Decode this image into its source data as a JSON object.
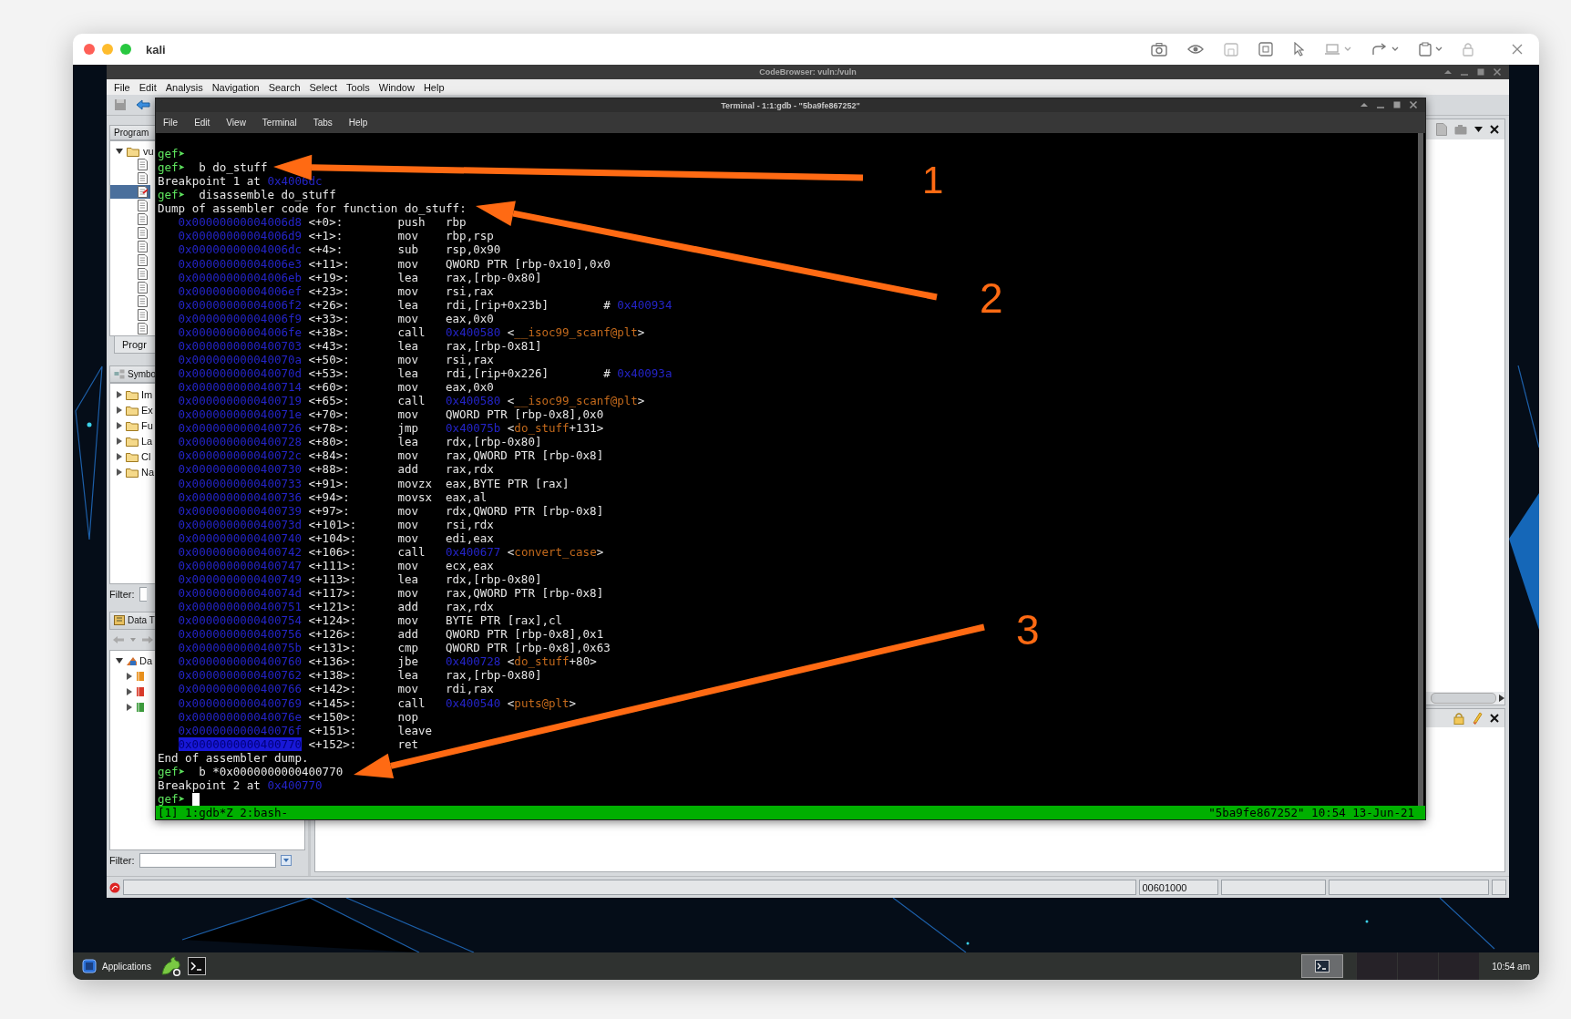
{
  "host_window": {
    "title": "kali"
  },
  "ghidra": {
    "title": "CodeBrowser: vuln:/vuln",
    "menu": [
      "File",
      "Edit",
      "Analysis",
      "Navigation",
      "Search",
      "Select",
      "Tools",
      "Window",
      "Help"
    ],
    "program_tree": {
      "header": "Program",
      "root": {
        "label": "vu",
        "expanded": true,
        "children": [
          {
            "selected": false
          },
          {
            "selected": false
          },
          {
            "selected": true
          },
          {
            "selected": false
          },
          {
            "selected": false
          },
          {
            "selected": false
          },
          {
            "selected": false
          },
          {
            "selected": false
          },
          {
            "selected": false
          },
          {
            "selected": false
          },
          {
            "selected": false
          },
          {
            "selected": false
          },
          {
            "selected": false
          }
        ]
      },
      "tab": "Progr"
    },
    "symbol_tree": {
      "header": "Symbo",
      "items": [
        {
          "label": "Im",
          "expanded": false
        },
        {
          "label": "Ex",
          "expanded": false
        },
        {
          "label": "Fu",
          "expanded": false
        },
        {
          "label": "La",
          "expanded": false
        },
        {
          "label": "Cl",
          "expanded": false
        },
        {
          "label": "Na",
          "expanded": false
        }
      ],
      "filter_label": "Filter:"
    },
    "data_type_manager": {
      "header": "Data T",
      "root": {
        "label": "Da",
        "expanded": true,
        "children": [
          {
            "color": "#e8901c",
            "expanded": false
          },
          {
            "color": "#d83a2a",
            "expanded": false
          },
          {
            "color": "#3c9a3c",
            "expanded": false
          }
        ]
      },
      "filter_label": "Filter:"
    },
    "status_bar": {
      "address": "00601000"
    }
  },
  "terminal": {
    "title": "Terminal - 1:1:gdb - \"5ba9fe867252\"",
    "menu": [
      "File",
      "Edit",
      "View",
      "Terminal",
      "Tabs",
      "Help"
    ],
    "lines": [
      {
        "kind": "text",
        "segments": [
          {
            "kind": "prompt",
            "text": "gef➤"
          }
        ]
      },
      {
        "kind": "text",
        "segments": [
          {
            "kind": "prompt",
            "text": "gef➤"
          },
          {
            "kind": "plain",
            "text": "  b do_stuff"
          }
        ]
      },
      {
        "kind": "text",
        "segments": [
          {
            "kind": "plain",
            "text": "Breakpoint 1 at "
          },
          {
            "kind": "address",
            "text": "0x4006dc"
          }
        ]
      },
      {
        "kind": "text",
        "segments": [
          {
            "kind": "prompt",
            "text": "gef➤"
          },
          {
            "kind": "plain",
            "text": "  disassemble do_stuff"
          }
        ]
      },
      {
        "kind": "text",
        "segments": [
          {
            "kind": "plain",
            "text": "Dump of assembler code for function do_stuff:"
          }
        ]
      },
      {
        "kind": "asm",
        "segments": [
          {
            "kind": "address",
            "text": "0x00000000004006d8"
          },
          {
            "kind": "plain",
            "text": " <+0>:\tpush   rbp"
          }
        ]
      },
      {
        "kind": "asm",
        "segments": [
          {
            "kind": "address",
            "text": "0x00000000004006d9"
          },
          {
            "kind": "plain",
            "text": " <+1>:\tmov    rbp,rsp"
          }
        ]
      },
      {
        "kind": "asm",
        "segments": [
          {
            "kind": "address",
            "text": "0x00000000004006dc"
          },
          {
            "kind": "plain",
            "text": " <+4>:\tsub    rsp,0x90"
          }
        ]
      },
      {
        "kind": "asm",
        "segments": [
          {
            "kind": "address",
            "text": "0x00000000004006e3"
          },
          {
            "kind": "plain",
            "text": " <+11>:\tmov    QWORD PTR [rbp-0x10],0x0"
          }
        ]
      },
      {
        "kind": "asm",
        "segments": [
          {
            "kind": "address",
            "text": "0x00000000004006eb"
          },
          {
            "kind": "plain",
            "text": " <+19>:\tlea    rax,[rbp-0x80]"
          }
        ]
      },
      {
        "kind": "asm",
        "segments": [
          {
            "kind": "address",
            "text": "0x00000000004006ef"
          },
          {
            "kind": "plain",
            "text": " <+23>:\tmov    rsi,rax"
          }
        ]
      },
      {
        "kind": "asm",
        "segments": [
          {
            "kind": "address",
            "text": "0x00000000004006f2"
          },
          {
            "kind": "plain",
            "text": " <+26>:\tlea    rdi,[rip+0x23b]        # "
          },
          {
            "kind": "address",
            "text": "0x400934"
          }
        ]
      },
      {
        "kind": "asm",
        "segments": [
          {
            "kind": "address",
            "text": "0x00000000004006f9"
          },
          {
            "kind": "plain",
            "text": " <+33>:\tmov    eax,0x0"
          }
        ]
      },
      {
        "kind": "asm",
        "segments": [
          {
            "kind": "address",
            "text": "0x00000000004006fe"
          },
          {
            "kind": "plain",
            "text": " <+38>:\tcall   "
          },
          {
            "kind": "address",
            "text": "0x400580"
          },
          {
            "kind": "plain",
            "text": " <"
          },
          {
            "kind": "symbol",
            "text": "__isoc99_scanf@plt"
          },
          {
            "kind": "plain",
            "text": ">"
          }
        ]
      },
      {
        "kind": "asm",
        "segments": [
          {
            "kind": "address",
            "text": "0x0000000000400703"
          },
          {
            "kind": "plain",
            "text": " <+43>:\tlea    rax,[rbp-0x81]"
          }
        ]
      },
      {
        "kind": "asm",
        "segments": [
          {
            "kind": "address",
            "text": "0x000000000040070a"
          },
          {
            "kind": "plain",
            "text": " <+50>:\tmov    rsi,rax"
          }
        ]
      },
      {
        "kind": "asm",
        "segments": [
          {
            "kind": "address",
            "text": "0x000000000040070d"
          },
          {
            "kind": "plain",
            "text": " <+53>:\tlea    rdi,[rip+0x226]        # "
          },
          {
            "kind": "address",
            "text": "0x40093a"
          }
        ]
      },
      {
        "kind": "asm",
        "segments": [
          {
            "kind": "address",
            "text": "0x0000000000400714"
          },
          {
            "kind": "plain",
            "text": " <+60>:\tmov    eax,0x0"
          }
        ]
      },
      {
        "kind": "asm",
        "segments": [
          {
            "kind": "address",
            "text": "0x0000000000400719"
          },
          {
            "kind": "plain",
            "text": " <+65>:\tcall   "
          },
          {
            "kind": "address",
            "text": "0x400580"
          },
          {
            "kind": "plain",
            "text": " <"
          },
          {
            "kind": "symbol",
            "text": "__isoc99_scanf@plt"
          },
          {
            "kind": "plain",
            "text": ">"
          }
        ]
      },
      {
        "kind": "asm",
        "segments": [
          {
            "kind": "address",
            "text": "0x000000000040071e"
          },
          {
            "kind": "plain",
            "text": " <+70>:\tmov    QWORD PTR [rbp-0x8],0x0"
          }
        ]
      },
      {
        "kind": "asm",
        "segments": [
          {
            "kind": "address",
            "text": "0x0000000000400726"
          },
          {
            "kind": "plain",
            "text": " <+78>:\tjmp    "
          },
          {
            "kind": "address",
            "text": "0x40075b"
          },
          {
            "kind": "plain",
            "text": " <"
          },
          {
            "kind": "symbol",
            "text": "do_stuff"
          },
          {
            "kind": "plain",
            "text": "+131>"
          }
        ]
      },
      {
        "kind": "asm",
        "segments": [
          {
            "kind": "address",
            "text": "0x0000000000400728"
          },
          {
            "kind": "plain",
            "text": " <+80>:\tlea    rdx,[rbp-0x80]"
          }
        ]
      },
      {
        "kind": "asm",
        "segments": [
          {
            "kind": "address",
            "text": "0x000000000040072c"
          },
          {
            "kind": "plain",
            "text": " <+84>:\tmov    rax,QWORD PTR [rbp-0x8]"
          }
        ]
      },
      {
        "kind": "asm",
        "segments": [
          {
            "kind": "address",
            "text": "0x0000000000400730"
          },
          {
            "kind": "plain",
            "text": " <+88>:\tadd    rax,rdx"
          }
        ]
      },
      {
        "kind": "asm",
        "segments": [
          {
            "kind": "address",
            "text": "0x0000000000400733"
          },
          {
            "kind": "plain",
            "text": " <+91>:\tmovzx  eax,BYTE PTR [rax]"
          }
        ]
      },
      {
        "kind": "asm",
        "segments": [
          {
            "kind": "address",
            "text": "0x0000000000400736"
          },
          {
            "kind": "plain",
            "text": " <+94>:\tmovsx  eax,al"
          }
        ]
      },
      {
        "kind": "asm",
        "segments": [
          {
            "kind": "address",
            "text": "0x0000000000400739"
          },
          {
            "kind": "plain",
            "text": " <+97>:\tmov    rdx,QWORD PTR [rbp-0x8]"
          }
        ]
      },
      {
        "kind": "asm",
        "segments": [
          {
            "kind": "address",
            "text": "0x000000000040073d"
          },
          {
            "kind": "plain",
            "text": " <+101>:\tmov    rsi,rdx"
          }
        ]
      },
      {
        "kind": "asm",
        "segments": [
          {
            "kind": "address",
            "text": "0x0000000000400740"
          },
          {
            "kind": "plain",
            "text": " <+104>:\tmov    edi,eax"
          }
        ]
      },
      {
        "kind": "asm",
        "segments": [
          {
            "kind": "address",
            "text": "0x0000000000400742"
          },
          {
            "kind": "plain",
            "text": " <+106>:\tcall   "
          },
          {
            "kind": "address",
            "text": "0x400677"
          },
          {
            "kind": "plain",
            "text": " <"
          },
          {
            "kind": "symbol",
            "text": "convert_case"
          },
          {
            "kind": "plain",
            "text": ">"
          }
        ]
      },
      {
        "kind": "asm",
        "segments": [
          {
            "kind": "address",
            "text": "0x0000000000400747"
          },
          {
            "kind": "plain",
            "text": " <+111>:\tmov    ecx,eax"
          }
        ]
      },
      {
        "kind": "asm",
        "segments": [
          {
            "kind": "address",
            "text": "0x0000000000400749"
          },
          {
            "kind": "plain",
            "text": " <+113>:\tlea    rdx,[rbp-0x80]"
          }
        ]
      },
      {
        "kind": "asm",
        "segments": [
          {
            "kind": "address",
            "text": "0x000000000040074d"
          },
          {
            "kind": "plain",
            "text": " <+117>:\tmov    rax,QWORD PTR [rbp-0x8]"
          }
        ]
      },
      {
        "kind": "asm",
        "segments": [
          {
            "kind": "address",
            "text": "0x0000000000400751"
          },
          {
            "kind": "plain",
            "text": " <+121>:\tadd    rax,rdx"
          }
        ]
      },
      {
        "kind": "asm",
        "segments": [
          {
            "kind": "address",
            "text": "0x0000000000400754"
          },
          {
            "kind": "plain",
            "text": " <+124>:\tmov    BYTE PTR [rax],cl"
          }
        ]
      },
      {
        "kind": "asm",
        "segments": [
          {
            "kind": "address",
            "text": "0x0000000000400756"
          },
          {
            "kind": "plain",
            "text": " <+126>:\tadd    QWORD PTR [rbp-0x8],0x1"
          }
        ]
      },
      {
        "kind": "asm",
        "segments": [
          {
            "kind": "address",
            "text": "0x000000000040075b"
          },
          {
            "kind": "plain",
            "text": " <+131>:\tcmp    QWORD PTR [rbp-0x8],0x63"
          }
        ]
      },
      {
        "kind": "asm",
        "segments": [
          {
            "kind": "address",
            "text": "0x0000000000400760"
          },
          {
            "kind": "plain",
            "text": " <+136>:\tjbe    "
          },
          {
            "kind": "address",
            "text": "0x400728"
          },
          {
            "kind": "plain",
            "text": " <"
          },
          {
            "kind": "symbol",
            "text": "do_stuff"
          },
          {
            "kind": "plain",
            "text": "+80>"
          }
        ]
      },
      {
        "kind": "asm",
        "segments": [
          {
            "kind": "address",
            "text": "0x0000000000400762"
          },
          {
            "kind": "plain",
            "text": " <+138>:\tlea    rax,[rbp-0x80]"
          }
        ]
      },
      {
        "kind": "asm",
        "segments": [
          {
            "kind": "address",
            "text": "0x0000000000400766"
          },
          {
            "kind": "plain",
            "text": " <+142>:\tmov    rdi,rax"
          }
        ]
      },
      {
        "kind": "asm",
        "segments": [
          {
            "kind": "address",
            "text": "0x0000000000400769"
          },
          {
            "kind": "plain",
            "text": " <+145>:\tcall   "
          },
          {
            "kind": "address",
            "text": "0x400540"
          },
          {
            "kind": "plain",
            "text": " <"
          },
          {
            "kind": "symbol",
            "text": "puts@plt"
          },
          {
            "kind": "plain",
            "text": ">"
          }
        ]
      },
      {
        "kind": "asm",
        "segments": [
          {
            "kind": "address",
            "text": "0x000000000040076e"
          },
          {
            "kind": "plain",
            "text": " <+150>:\tnop"
          }
        ]
      },
      {
        "kind": "asm",
        "segments": [
          {
            "kind": "address",
            "text": "0x000000000040076f"
          },
          {
            "kind": "plain",
            "text": " <+151>:\tleave"
          }
        ]
      },
      {
        "kind": "asm",
        "segments": [
          {
            "kind": "selection",
            "text": "0x0000000000400770"
          },
          {
            "kind": "plain",
            "text": " <+152>:\tret"
          }
        ]
      },
      {
        "kind": "text",
        "segments": [
          {
            "kind": "plain",
            "text": "End of assembler dump."
          }
        ]
      },
      {
        "kind": "text",
        "segments": [
          {
            "kind": "prompt",
            "text": "gef➤"
          },
          {
            "kind": "plain",
            "text": "  b *0x0000000000400770"
          }
        ]
      },
      {
        "kind": "text",
        "segments": [
          {
            "kind": "plain",
            "text": "Breakpoint 2 at "
          },
          {
            "kind": "address",
            "text": "0x400770"
          }
        ]
      },
      {
        "kind": "text",
        "segments": [
          {
            "kind": "prompt",
            "text": "gef➤"
          }
        ]
      }
    ],
    "cursor": true,
    "status_left": "[1] 1:gdb*Z 2:bash-",
    "status_right": "\"5ba9fe867252\" 10:54 13-Jun-21"
  },
  "annotations": [
    {
      "label": "1"
    },
    {
      "label": "2"
    },
    {
      "label": "3"
    }
  ],
  "taskbar": {
    "menu_label": "Applications",
    "clock": "10:54 am"
  }
}
